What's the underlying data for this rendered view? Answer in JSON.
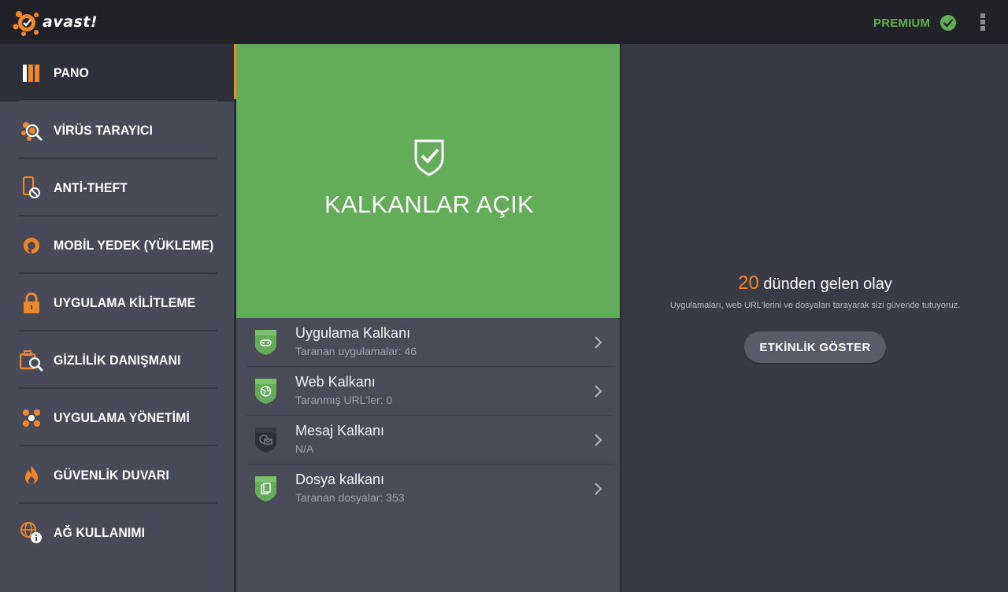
{
  "header": {
    "logo_text": "avast!",
    "premium_label": "PREMIUM"
  },
  "sidebar": {
    "items": [
      {
        "label": "PANO",
        "icon": "dashboard-icon",
        "active": true
      },
      {
        "label": "VİRÜS TARAYICI",
        "icon": "virus-scan-icon"
      },
      {
        "label": "ANTİ-THEFT",
        "icon": "anti-theft-phone-icon"
      },
      {
        "label": "MOBİL YEDEK (YÜKLEME)",
        "icon": "backup-icon"
      },
      {
        "label": "UYGULAMA KİLİTLEME",
        "icon": "padlock-icon"
      },
      {
        "label": "GİZLİLİK DANIŞMANI",
        "icon": "privacy-advisor-icon"
      },
      {
        "label": "UYGULAMA YÖNETİMİ",
        "icon": "app-management-icon"
      },
      {
        "label": "GÜVENLİK DUVARI",
        "icon": "firewall-flame-icon"
      },
      {
        "label": "AĞ KULLANIMI",
        "icon": "network-usage-globe-icon"
      }
    ]
  },
  "status": {
    "title": "KALKANLAR AÇIK"
  },
  "shields": [
    {
      "title": "Uygulama Kalkanı",
      "subtitle": "Taranan uygulamalar: 46",
      "icon": "app-shield-icon",
      "enabled": true
    },
    {
      "title": "Web Kalkanı",
      "subtitle": "Taranmış URL'ler: 0",
      "icon": "web-shield-icon",
      "enabled": true
    },
    {
      "title": "Mesaj Kalkanı",
      "subtitle": "N/A",
      "icon": "message-shield-icon",
      "enabled": false
    },
    {
      "title": "Dosya kalkanı",
      "subtitle": "Taranan dosyalar: 353",
      "icon": "file-shield-icon",
      "enabled": true
    }
  ],
  "events": {
    "count": "20",
    "text": " dünden gelen olay",
    "description": "Uygulamaları, web URL'lerini ve dosyaları tarayarak sizi güvende tutuyoruz.",
    "button_label": "ETKİNLİK GÖSTER"
  },
  "colors": {
    "accent_orange": "#f0882a",
    "shield_green": "#63ad58",
    "topbar": "#202228",
    "sidebar": "#484b57"
  }
}
